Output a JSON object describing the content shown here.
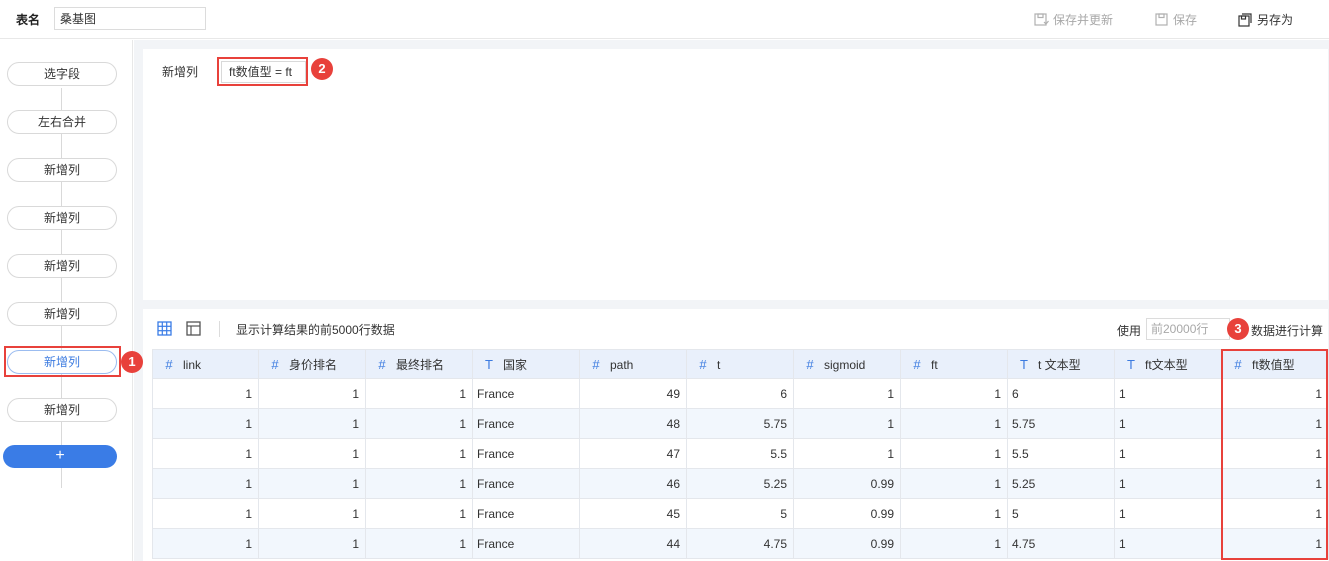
{
  "topbar": {
    "table_name_label": "表名",
    "table_name_value": "桑基图",
    "save_and_update_label": "保存并更新",
    "save_label": "保存",
    "save_as_label": "另存为"
  },
  "steps": [
    "选字段",
    "左右合并",
    "新增列",
    "新增列",
    "新增列",
    "新增列",
    "新增列",
    "新增列"
  ],
  "add_step_label": "+",
  "editor": {
    "label": "新增列",
    "formula": "ft数值型 = ft"
  },
  "badges": [
    "1",
    "2",
    "3"
  ],
  "data": {
    "info": "显示计算结果的前5000行数据",
    "use_label": "使用",
    "rows_placeholder": "前20000行",
    "calc_label": "数据进行计算",
    "columns": [
      {
        "type": "#",
        "name": "link"
      },
      {
        "type": "#",
        "name": "身价排名"
      },
      {
        "type": "#",
        "name": "最终排名"
      },
      {
        "type": "T",
        "name": "国家"
      },
      {
        "type": "#",
        "name": "path"
      },
      {
        "type": "#",
        "name": "t"
      },
      {
        "type": "#",
        "name": "sigmoid"
      },
      {
        "type": "#",
        "name": "ft"
      },
      {
        "type": "T",
        "name": "t 文本型"
      },
      {
        "type": "T",
        "name": "ft文本型"
      },
      {
        "type": "#",
        "name": "ft数值型"
      }
    ],
    "rows": [
      [
        "1",
        "1",
        "1",
        "France",
        "49",
        "6",
        "1",
        "1",
        "6",
        "1",
        "1"
      ],
      [
        "1",
        "1",
        "1",
        "France",
        "48",
        "5.75",
        "1",
        "1",
        "5.75",
        "1",
        "1"
      ],
      [
        "1",
        "1",
        "1",
        "France",
        "47",
        "5.5",
        "1",
        "1",
        "5.5",
        "1",
        "1"
      ],
      [
        "1",
        "1",
        "1",
        "France",
        "46",
        "5.25",
        "0.99",
        "1",
        "5.25",
        "1",
        "1"
      ],
      [
        "1",
        "1",
        "1",
        "France",
        "45",
        "5",
        "0.99",
        "1",
        "5",
        "1",
        "1"
      ],
      [
        "1",
        "1",
        "1",
        "France",
        "44",
        "4.75",
        "0.99",
        "1",
        "4.75",
        "1",
        "1"
      ]
    ]
  },
  "colors": {
    "accent": "#3a7ce6",
    "highlight": "#e8413b",
    "header_bg": "#e9f0fb"
  }
}
